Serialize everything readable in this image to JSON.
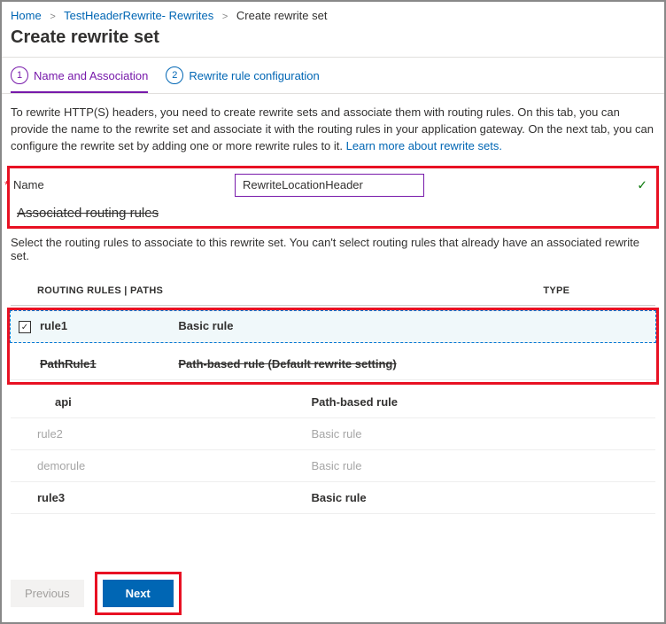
{
  "breadcrumb": {
    "items": [
      "Home",
      "TestHeaderRewrite- Rewrites",
      "Create rewrite set"
    ]
  },
  "pageTitle": "Create rewrite set",
  "tabs": {
    "t1": {
      "num": "1",
      "label": "Name and Association"
    },
    "t2": {
      "num": "2",
      "label": "Rewrite rule configuration"
    }
  },
  "description": {
    "text": "To rewrite HTTP(S) headers, you need to create rewrite sets and associate them with routing rules. On this tab, you can provide the name to the rewrite set and associate it with the routing rules in your application gateway. On the next tab, you can configure the rewrite set by adding one or more rewrite rules to it.  ",
    "link": "Learn more about rewrite sets."
  },
  "nameField": {
    "label": "Name",
    "value": "RewriteLocationHeader"
  },
  "section": {
    "heading": "Associated routing rules",
    "sub": "Select the routing rules to associate to this rewrite set. You can't select routing rules that already have an associated rewrite set."
  },
  "table": {
    "headers": {
      "c1": "ROUTING RULES | PATHS",
      "c2": "TYPE"
    },
    "rows": [
      {
        "name": "rule1",
        "type": "Basic rule",
        "selected": true,
        "strike": false,
        "dim": false
      },
      {
        "name": "PathRule1",
        "type": "Path-based rule (Default rewrite setting)",
        "selected": false,
        "strike": true,
        "dim": false
      },
      {
        "name": "api",
        "type": "Path-based rule",
        "selected": false,
        "strike": false,
        "dim": false,
        "indent": true
      },
      {
        "name": "rule2",
        "type": "Basic rule",
        "selected": false,
        "strike": false,
        "dim": true
      },
      {
        "name": "demorule",
        "type": "Basic rule",
        "selected": false,
        "strike": false,
        "dim": true
      },
      {
        "name": "rule3",
        "type": "Basic rule",
        "selected": false,
        "strike": false,
        "dim": false
      }
    ]
  },
  "footer": {
    "prev": "Previous",
    "next": "Next"
  }
}
